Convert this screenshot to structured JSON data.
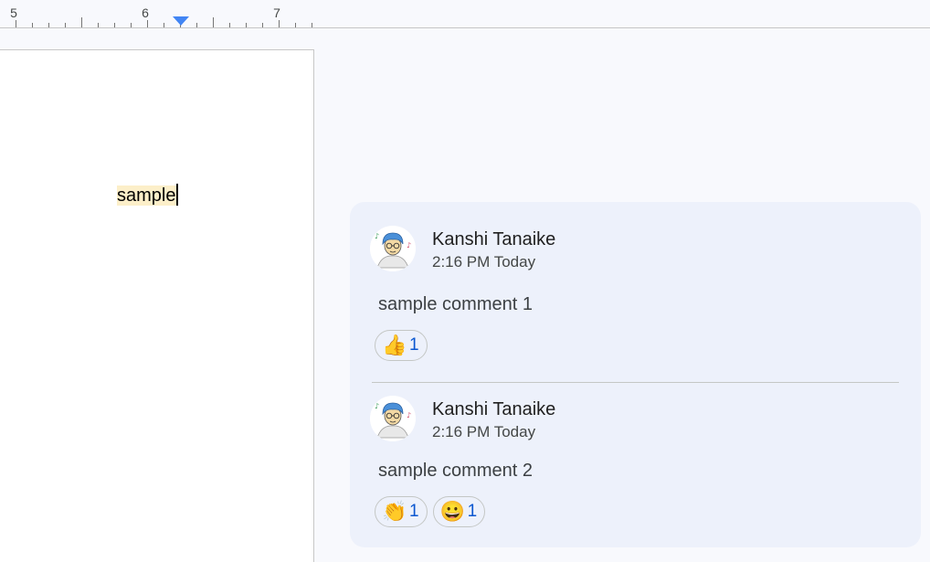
{
  "ruler": {
    "numbers": [
      "5",
      "6",
      "7"
    ]
  },
  "document": {
    "text": "sample"
  },
  "comments": [
    {
      "author": "Kanshi Tanaike",
      "time": "2:16 PM Today",
      "body": "sample comment 1",
      "reactions": [
        {
          "emoji": "👍",
          "icon": "thumbs-up-icon",
          "count": "1"
        }
      ]
    },
    {
      "author": "Kanshi Tanaike",
      "time": "2:16 PM Today",
      "body": "sample comment 2",
      "reactions": [
        {
          "emoji": "👏",
          "icon": "clapping-hands-icon",
          "count": "1"
        },
        {
          "emoji": "😀",
          "icon": "grinning-face-icon",
          "count": "1"
        }
      ]
    }
  ],
  "colors": {
    "indent_marker": "#4285f4",
    "highlight": "#fcefc9",
    "reaction_count": "#0b57d0",
    "card_background": "#edf1fb"
  }
}
